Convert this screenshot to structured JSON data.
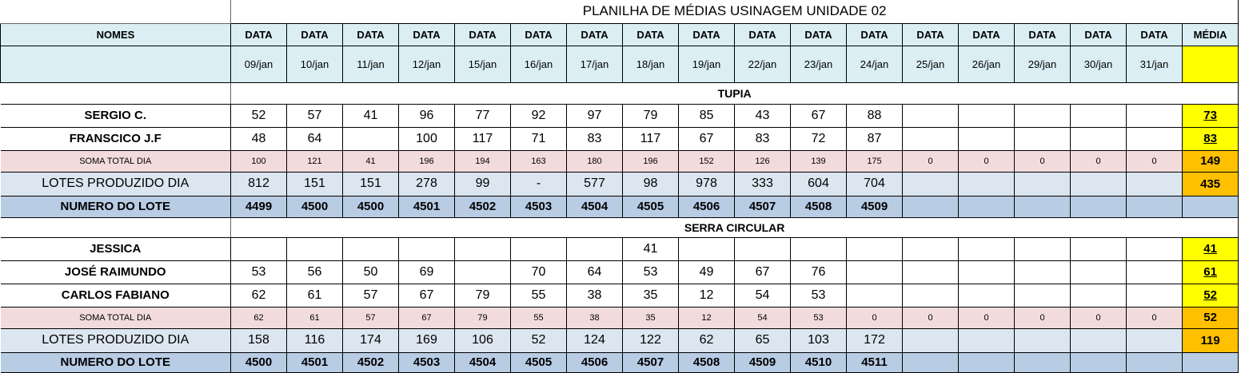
{
  "title": "PLANILHA DE MÉDIAS USINAGEM UNIDADE 02",
  "header": {
    "names_label": "NOMES",
    "date_label": "DATA",
    "media_label": "MÉDIA",
    "dates": [
      "09/jan",
      "10/jan",
      "11/jan",
      "12/jan",
      "15/jan",
      "16/jan",
      "17/jan",
      "18/jan",
      "19/jan",
      "22/jan",
      "23/jan",
      "24/jan",
      "25/jan",
      "26/jan",
      "29/jan",
      "30/jan",
      "31/jan"
    ]
  },
  "colors": {
    "header_bg": "#daeef3",
    "soma_bg": "#f2dcdb",
    "lotes_bg": "#dce6f1",
    "numero_bg": "#b8cce4",
    "media_yellow": "#ffff00",
    "media_orange": "#ffc000"
  },
  "sections": [
    {
      "title": "TUPIA",
      "operators": [
        {
          "name": "SERGIO C.",
          "values": [
            "52",
            "57",
            "41",
            "96",
            "77",
            "92",
            "97",
            "79",
            "85",
            "43",
            "67",
            "88",
            "",
            "",
            "",
            "",
            ""
          ],
          "media": "73"
        },
        {
          "name": "FRANSCICO J.F",
          "values": [
            "48",
            "64",
            "",
            "100",
            "117",
            "71",
            "83",
            "117",
            "67",
            "83",
            "72",
            "87",
            "",
            "",
            "",
            "",
            ""
          ],
          "media": "83"
        }
      ],
      "soma": {
        "label": "SOMA TOTAL DIA",
        "values": [
          "100",
          "121",
          "41",
          "196",
          "194",
          "163",
          "180",
          "196",
          "152",
          "126",
          "139",
          "175",
          "0",
          "0",
          "0",
          "0",
          "0"
        ],
        "media": "149"
      },
      "lotes": {
        "label": "LOTES PRODUZIDO DIA",
        "values": [
          "812",
          "151",
          "151",
          "278",
          "99",
          "-",
          "577",
          "98",
          "978",
          "333",
          "604",
          "704",
          "",
          "",
          "",
          "",
          ""
        ],
        "media": "435"
      },
      "numero": {
        "label": "NUMERO DO LOTE",
        "values": [
          "4499",
          "4500",
          "4500",
          "4501",
          "4502",
          "4503",
          "4504",
          "4505",
          "4506",
          "4507",
          "4508",
          "4509",
          "",
          "",
          "",
          "",
          ""
        ],
        "media": ""
      }
    },
    {
      "title": "SERRA CIRCULAR",
      "operators": [
        {
          "name": "JESSICA",
          "values": [
            "",
            "",
            "",
            "",
            "",
            "",
            "",
            "41",
            "",
            "",
            "",
            "",
            "",
            "",
            "",
            "",
            ""
          ],
          "media": "41"
        },
        {
          "name": "JOSÉ RAIMUNDO",
          "values": [
            "53",
            "56",
            "50",
            "69",
            "",
            "70",
            "64",
            "53",
            "49",
            "67",
            "76",
            "",
            "",
            "",
            "",
            "",
            ""
          ],
          "media": "61"
        },
        {
          "name": "CARLOS FABIANO",
          "values": [
            "62",
            "61",
            "57",
            "67",
            "79",
            "55",
            "38",
            "35",
            "12",
            "54",
            "53",
            "",
            "",
            "",
            "",
            "",
            ""
          ],
          "media": "52"
        }
      ],
      "soma": {
        "label": "SOMA TOTAL DIA",
        "values": [
          "62",
          "61",
          "57",
          "67",
          "79",
          "55",
          "38",
          "35",
          "12",
          "54",
          "53",
          "0",
          "0",
          "0",
          "0",
          "0",
          "0"
        ],
        "media": "52"
      },
      "lotes": {
        "label": "LOTES PRODUZIDO DIA",
        "values": [
          "158",
          "116",
          "174",
          "169",
          "106",
          "52",
          "124",
          "122",
          "62",
          "65",
          "103",
          "172",
          "",
          "",
          "",
          "",
          ""
        ],
        "media": "119"
      },
      "numero": {
        "label": "NUMERO DO LOTE",
        "values": [
          "4500",
          "4501",
          "4502",
          "4503",
          "4504",
          "4505",
          "4506",
          "4507",
          "4508",
          "4509",
          "4510",
          "4511",
          "",
          "",
          "",
          "",
          ""
        ],
        "media": ""
      }
    }
  ]
}
